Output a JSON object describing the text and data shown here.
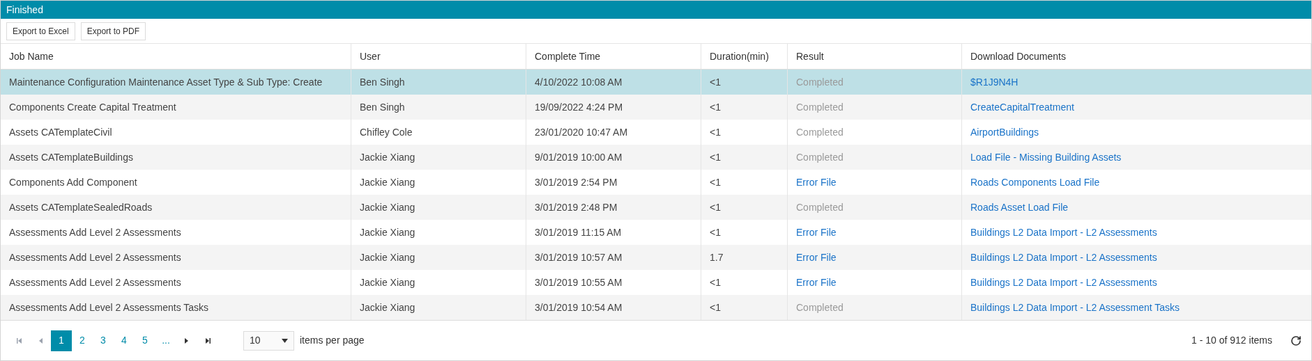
{
  "panel": {
    "title": "Finished"
  },
  "toolbar": {
    "buttons": [
      "Export to Excel",
      "Export to PDF"
    ]
  },
  "table": {
    "columns": [
      "Job Name",
      "User",
      "Complete Time",
      "Duration(min)",
      "Result",
      "Download Documents"
    ],
    "rows": [
      {
        "selected": true,
        "job": "Maintenance Configuration Maintenance Asset Type & Sub Type: Create",
        "user": "Ben Singh",
        "time": "4/10/2022 10:08 AM",
        "duration": "<1",
        "result": {
          "kind": "text",
          "label": "Completed"
        },
        "document": "$R1J9N4H"
      },
      {
        "selected": false,
        "job": "Components Create Capital Treatment",
        "user": "Ben Singh",
        "time": "19/09/2022 4:24 PM",
        "duration": "<1",
        "result": {
          "kind": "text",
          "label": "Completed"
        },
        "document": "CreateCapitalTreatment"
      },
      {
        "selected": false,
        "job": "Assets CATemplateCivil",
        "user": "Chifley Cole",
        "time": "23/01/2020 10:47 AM",
        "duration": "<1",
        "result": {
          "kind": "text",
          "label": "Completed"
        },
        "document": "AirportBuildings"
      },
      {
        "selected": false,
        "job": "Assets CATemplateBuildings",
        "user": "Jackie Xiang",
        "time": "9/01/2019 10:00 AM",
        "duration": "<1",
        "result": {
          "kind": "text",
          "label": "Completed"
        },
        "document": "Load File - Missing Building Assets"
      },
      {
        "selected": false,
        "job": "Components Add Component",
        "user": "Jackie Xiang",
        "time": "3/01/2019 2:54 PM",
        "duration": "<1",
        "result": {
          "kind": "link",
          "label": "Error File"
        },
        "document": "Roads Components Load File"
      },
      {
        "selected": false,
        "job": "Assets CATemplateSealedRoads",
        "user": "Jackie Xiang",
        "time": "3/01/2019 2:48 PM",
        "duration": "<1",
        "result": {
          "kind": "text",
          "label": "Completed"
        },
        "document": "Roads Asset Load File"
      },
      {
        "selected": false,
        "job": "Assessments Add Level 2 Assessments",
        "user": "Jackie Xiang",
        "time": "3/01/2019 11:15 AM",
        "duration": "<1",
        "result": {
          "kind": "link",
          "label": "Error File"
        },
        "document": "Buildings L2 Data Import - L2 Assessments"
      },
      {
        "selected": false,
        "job": "Assessments Add Level 2 Assessments",
        "user": "Jackie Xiang",
        "time": "3/01/2019 10:57 AM",
        "duration": "1.7",
        "result": {
          "kind": "link",
          "label": "Error File"
        },
        "document": "Buildings L2 Data Import - L2 Assessments"
      },
      {
        "selected": false,
        "job": "Assessments Add Level 2 Assessments",
        "user": "Jackie Xiang",
        "time": "3/01/2019 10:55 AM",
        "duration": "<1",
        "result": {
          "kind": "link",
          "label": "Error File"
        },
        "document": "Buildings L2 Data Import - L2 Assessments"
      },
      {
        "selected": false,
        "job": "Assessments Add Level 2 Assessments Tasks",
        "user": "Jackie Xiang",
        "time": "3/01/2019 10:54 AM",
        "duration": "<1",
        "result": {
          "kind": "text",
          "label": "Completed"
        },
        "document": "Buildings L2 Data Import - L2 Assessment Tasks"
      }
    ]
  },
  "pager": {
    "first": {
      "disabled": true
    },
    "prev": {
      "disabled": true
    },
    "pages": [
      {
        "label": "1",
        "selected": true
      },
      {
        "label": "2",
        "selected": false
      },
      {
        "label": "3",
        "selected": false
      },
      {
        "label": "4",
        "selected": false
      },
      {
        "label": "5",
        "selected": false
      },
      {
        "label": "...",
        "selected": false
      }
    ],
    "next": {
      "disabled": false
    },
    "last": {
      "disabled": false
    },
    "page_size": "10",
    "page_size_label": "items per page",
    "summary": "1 - 10 of 912 items"
  }
}
